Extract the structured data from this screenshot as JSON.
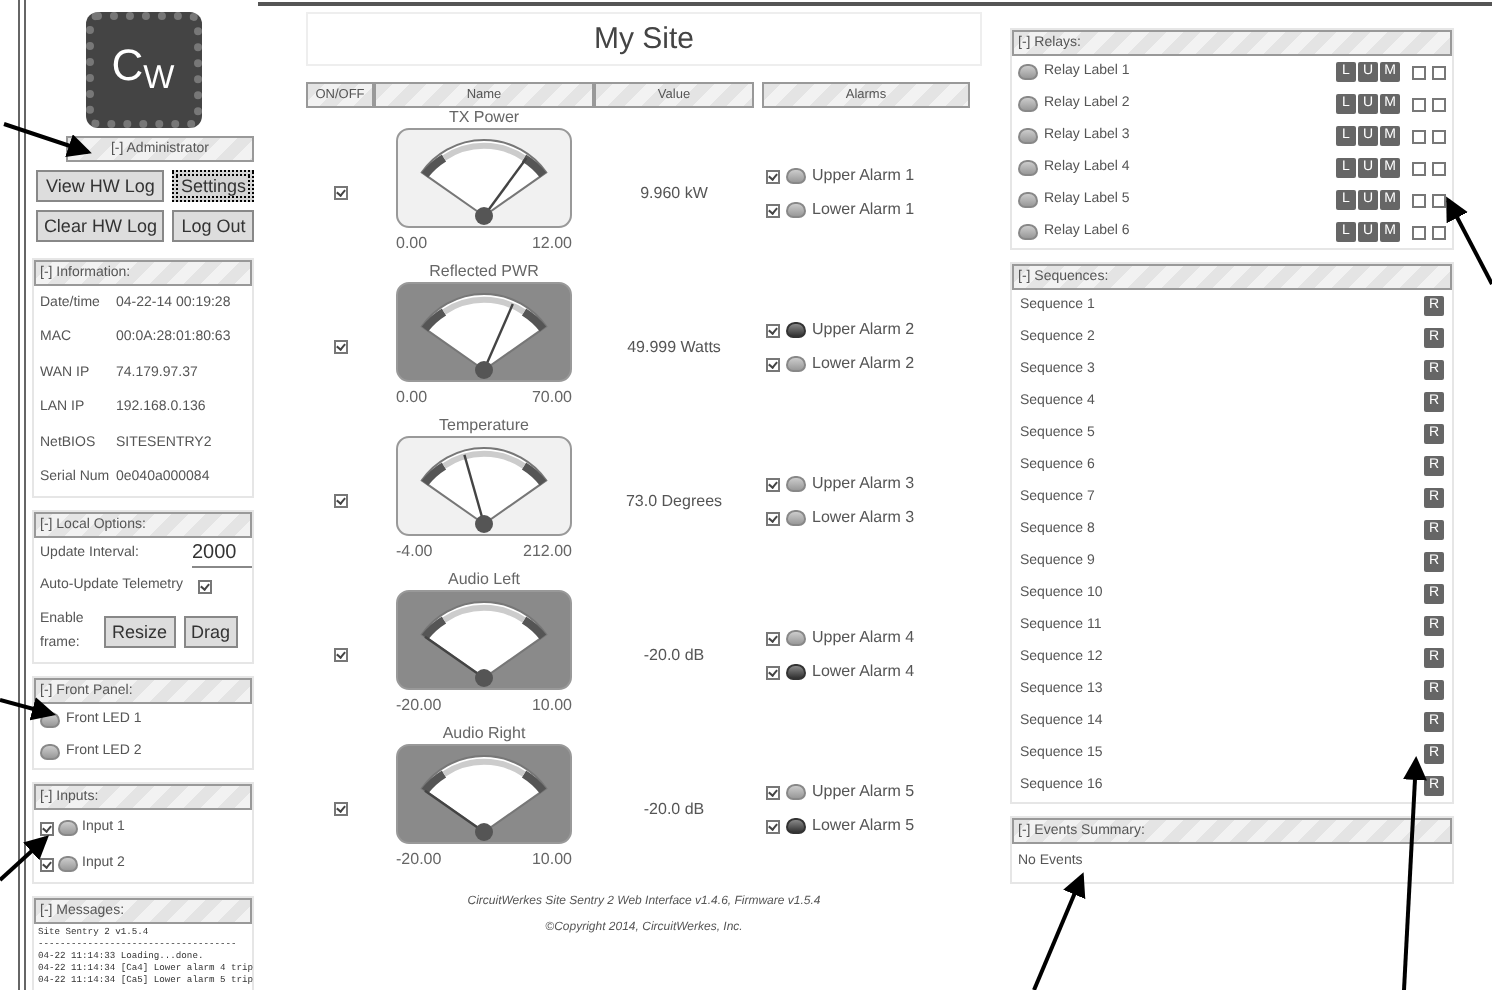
{
  "logo": "C$_{W}$",
  "administrator": {
    "header": "[-] Administrator",
    "buttons": [
      {
        "label": "View HW Log",
        "focused": false
      },
      {
        "label": "Settings",
        "focused": true
      },
      {
        "label": "Clear HW Log",
        "focused": false
      },
      {
        "label": "Log Out",
        "focused": false
      }
    ]
  },
  "information": {
    "header": "[-] Information:",
    "rows": [
      {
        "label": "Date/time",
        "value": "04-22-14 00:19:28"
      },
      {
        "label": "MAC",
        "value": "00:0A:28:01:80:63"
      },
      {
        "label": "WAN IP",
        "value": "74.179.97.37"
      },
      {
        "label": "LAN IP",
        "value": "192.168.0.136"
      },
      {
        "label": "NetBIOS",
        "value": "SITESENTRY2"
      },
      {
        "label": "Serial Num",
        "value": "0e040a000084"
      }
    ]
  },
  "local_options": {
    "header": "[-] Local Options:",
    "update_interval": {
      "label": "Update Interval:",
      "value": "2000"
    },
    "auto_update": {
      "label": "Auto-Update Telemetry",
      "checked": true
    },
    "enable_frame": {
      "label": "Enable frame:",
      "buttons": [
        "Resize",
        "Drag"
      ]
    }
  },
  "front_panel": {
    "header": "[-] Front Panel:",
    "leds": [
      {
        "label": "Front LED 1",
        "on": false
      },
      {
        "label": "Front LED 2",
        "on": false
      }
    ]
  },
  "inputs": {
    "header": "[-] Inputs:",
    "items": [
      {
        "label": "Input 1",
        "checked": true,
        "on": false
      },
      {
        "label": "Input 2",
        "checked": true,
        "on": false
      }
    ]
  },
  "messages": {
    "header": "[-] Messages:",
    "lines": [
      "Site Sentry 2 v1.5.4",
      "------------------------------------",
      "04-22 11:14:33 Loading...done.",
      "04-22 11:14:34 [Ca4] Lower alarm 4 trip",
      "04-22 11:14:34 [Ca5] Lower alarm 5 trip"
    ]
  },
  "site": {
    "title": "My Site",
    "columns": [
      "ON/OFF",
      "Name",
      "Value",
      "Alarms"
    ],
    "channels": [
      {
        "name": "TX Power",
        "on": true,
        "alarm": false,
        "min": "0.00",
        "max": "12.00",
        "value": "9.960 kW",
        "alarms": [
          {
            "label": "Upper Alarm 1",
            "checked": true,
            "active": false
          },
          {
            "label": "Lower Alarm 1",
            "checked": true,
            "active": false
          }
        ]
      },
      {
        "name": "Reflected PWR",
        "on": true,
        "alarm": true,
        "min": "0.00",
        "max": "70.00",
        "value": "49.999 Watts",
        "alarms": [
          {
            "label": "Upper Alarm 2",
            "checked": true,
            "active": true
          },
          {
            "label": "Lower Alarm 2",
            "checked": true,
            "active": false
          }
        ]
      },
      {
        "name": "Temperature",
        "on": true,
        "alarm": false,
        "min": "-4.00",
        "max": "212.00",
        "value": "73.0 Degrees",
        "alarms": [
          {
            "label": "Upper Alarm 3",
            "checked": true,
            "active": false
          },
          {
            "label": "Lower Alarm 3",
            "checked": true,
            "active": false
          }
        ]
      },
      {
        "name": "Audio Left",
        "on": true,
        "alarm": true,
        "min": "-20.00",
        "max": "10.00",
        "value": "-20.0 dB",
        "alarms": [
          {
            "label": "Upper Alarm 4",
            "checked": true,
            "active": false
          },
          {
            "label": "Lower Alarm 4",
            "checked": true,
            "active": true
          }
        ]
      },
      {
        "name": "Audio Right",
        "on": true,
        "alarm": true,
        "min": "-20.00",
        "max": "10.00",
        "value": "-20.0 dB",
        "alarms": [
          {
            "label": "Upper Alarm 5",
            "checked": true,
            "active": false
          },
          {
            "label": "Lower Alarm 5",
            "checked": true,
            "active": true
          }
        ]
      }
    ],
    "footer": [
      "CircuitWerkes Site Sentry 2 Web Interface v1.4.6, Firmware v1.5.4",
      "©Copyright 2014, CircuitWerkes, Inc."
    ]
  },
  "relays": {
    "header": "[-] Relays:",
    "items": [
      {
        "label": "Relay Label 1",
        "on": false,
        "buttons": [
          "L",
          "U",
          "M"
        ],
        "checks": [
          false,
          false
        ]
      },
      {
        "label": "Relay Label 2",
        "on": false,
        "buttons": [
          "L",
          "U",
          "M"
        ],
        "checks": [
          false,
          false
        ]
      },
      {
        "label": "Relay Label 3",
        "on": false,
        "buttons": [
          "L",
          "U",
          "M"
        ],
        "checks": [
          false,
          false
        ]
      },
      {
        "label": "Relay Label 4",
        "on": false,
        "buttons": [
          "L",
          "U",
          "M"
        ],
        "checks": [
          false,
          false
        ]
      },
      {
        "label": "Relay Label 5",
        "on": false,
        "buttons": [
          "L",
          "U",
          "M"
        ],
        "checks": [
          false,
          false
        ]
      },
      {
        "label": "Relay Label 6",
        "on": false,
        "buttons": [
          "L",
          "U",
          "M"
        ],
        "checks": [
          false,
          false
        ]
      }
    ]
  },
  "sequences": {
    "header": "[-] Sequences:",
    "items": [
      {
        "label": "Sequence 1",
        "button": "R"
      },
      {
        "label": "Sequence 2",
        "button": "R"
      },
      {
        "label": "Sequence 3",
        "button": "R"
      },
      {
        "label": "Sequence 4",
        "button": "R"
      },
      {
        "label": "Sequence 5",
        "button": "R"
      },
      {
        "label": "Sequence 6",
        "button": "R"
      },
      {
        "label": "Sequence 7",
        "button": "R"
      },
      {
        "label": "Sequence 8",
        "button": "R"
      },
      {
        "label": "Sequence 9",
        "button": "R"
      },
      {
        "label": "Sequence 10",
        "button": "R"
      },
      {
        "label": "Sequence 11",
        "button": "R"
      },
      {
        "label": "Sequence 12",
        "button": "R"
      },
      {
        "label": "Sequence 13",
        "button": "R"
      },
      {
        "label": "Sequence 14",
        "button": "R"
      },
      {
        "label": "Sequence 15",
        "button": "R"
      },
      {
        "label": "Sequence 16",
        "button": "R"
      }
    ]
  },
  "events": {
    "header": "[-] Events Summary:",
    "text": "No Events"
  }
}
